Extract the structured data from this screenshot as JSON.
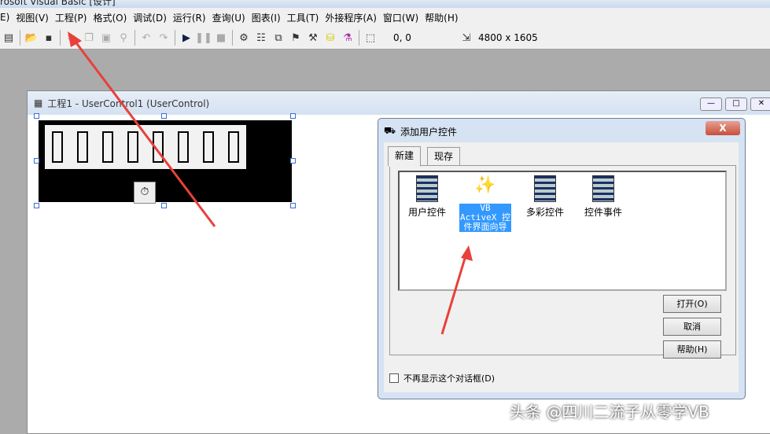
{
  "window": {
    "title": "rosoft Visual Basic [设计]"
  },
  "menu": [
    "E)",
    "视图(V)",
    "工程(P)",
    "格式(O)",
    "调试(D)",
    "运行(R)",
    "查询(U)",
    "图表(I)",
    "工具(T)",
    "外接程序(A)",
    "窗口(W)",
    "帮助(H)"
  ],
  "toolbar": {
    "position": "0, 0",
    "size": "4800 x 1605"
  },
  "designer": {
    "title": "工程1 - UserControl1 (UserControl)"
  },
  "dialog": {
    "title": "添加用户控件",
    "close": "X",
    "tabs": [
      "新建",
      "现存"
    ],
    "items": [
      "用户控件",
      "VB ActiveX 控件界面向导",
      "多彩控件",
      "控件事件"
    ],
    "buttons": {
      "open": "打开(O)",
      "cancel": "取消",
      "help": "帮助(H)"
    },
    "checkbox": "不再显示这个对话框(D)"
  },
  "watermark": "头条 @四川二流子从零学VB"
}
